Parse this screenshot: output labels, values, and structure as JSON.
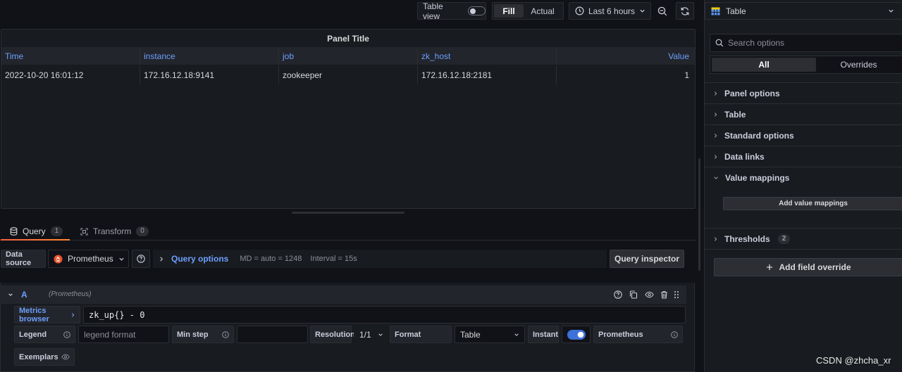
{
  "toolbar": {
    "table_view_label": "Table view",
    "fill_label": "Fill",
    "actual_label": "Actual",
    "time_range": "Last 6 hours"
  },
  "panel": {
    "title": "Panel Title",
    "columns": [
      "Time",
      "instance",
      "job",
      "zk_host",
      "Value"
    ],
    "rows": [
      [
        "2022-10-20 16:01:12",
        "172.16.12.18:9141",
        "zookeeper",
        "172.16.12.18:2181",
        "1"
      ]
    ]
  },
  "tabs": {
    "query_label": "Query",
    "query_count": "1",
    "transform_label": "Transform",
    "transform_count": "0"
  },
  "query_row": {
    "data_source_label": "Data source",
    "data_source_value": "Prometheus",
    "query_options_label": "Query options",
    "md_text": "MD = auto = 1248",
    "interval_text": "Interval = 15s",
    "inspector_label": "Query inspector"
  },
  "query": {
    "ref_id": "A",
    "source_hint": "(Prometheus)",
    "metrics_browser_label": "Metrics browser",
    "expression": "zk_up{} - 0",
    "legend_label": "Legend",
    "legend_placeholder": "legend format",
    "min_step_label": "Min step",
    "resolution_label": "Resolution",
    "resolution_value": "1/1",
    "format_label": "Format",
    "format_value": "Table",
    "instant_label": "Instant",
    "type_value": "Prometheus",
    "exemplars_label": "Exemplars"
  },
  "options_pane": {
    "visualization": "Table",
    "search_placeholder": "Search options",
    "tab_all": "All",
    "tab_overrides": "Overrides",
    "sections": [
      "Panel options",
      "Table",
      "Standard options",
      "Data links",
      "Value mappings"
    ],
    "add_value_mappings": "Add value mappings",
    "thresholds_label": "Thresholds",
    "thresholds_count": "2",
    "add_field_override": "Add field override"
  },
  "watermark": "CSDN @zhcha_xr",
  "colors": {
    "background": "#111217",
    "panel": "#181b1f",
    "accent_blue": "#6e9fff",
    "toggle_on": "#3d71d9",
    "tab_underline": "#f55f3e"
  }
}
